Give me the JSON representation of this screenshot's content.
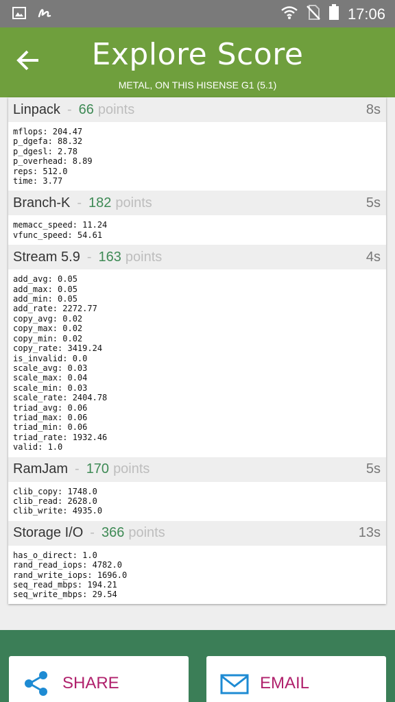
{
  "status_bar": {
    "time": "17:06"
  },
  "header": {
    "title": "Explore Score",
    "subtitle": "METAL, ON THIS HISENSE G1 (5.1)"
  },
  "unit_label": "points",
  "sections": [
    {
      "name": "Linpack",
      "score": "66",
      "duration": "8s",
      "metrics": [
        "mflops: 204.47",
        "p_dgefa: 88.32",
        "p_dgesl: 2.78",
        "p_overhead: 8.89",
        "reps: 512.0",
        "time: 3.77"
      ]
    },
    {
      "name": "Branch-K",
      "score": "182",
      "duration": "5s",
      "metrics": [
        "memacc_speed: 11.24",
        "vfunc_speed: 54.61"
      ]
    },
    {
      "name": "Stream 5.9",
      "score": "163",
      "duration": "4s",
      "metrics": [
        "add_avg: 0.05",
        "add_max: 0.05",
        "add_min: 0.05",
        "add_rate: 2272.77",
        "copy_avg: 0.02",
        "copy_max: 0.02",
        "copy_min: 0.02",
        "copy_rate: 3419.24",
        "is_invalid: 0.0",
        "scale_avg: 0.03",
        "scale_max: 0.04",
        "scale_min: 0.03",
        "scale_rate: 2404.78",
        "triad_avg: 0.06",
        "triad_max: 0.06",
        "triad_min: 0.06",
        "triad_rate: 1932.46",
        "valid: 1.0"
      ]
    },
    {
      "name": "RamJam",
      "score": "170",
      "duration": "5s",
      "metrics": [
        "clib_copy: 1748.0",
        "clib_read: 2628.0",
        "clib_write: 4935.0"
      ]
    },
    {
      "name": "Storage I/O",
      "score": "366",
      "duration": "13s",
      "metrics": [
        "has_o_direct: 1.0",
        "rand_read_iops: 4782.0",
        "rand_write_iops: 1696.0",
        "seq_read_mbps: 194.21",
        "seq_write_mbps: 29.54"
      ]
    }
  ],
  "actions": {
    "share_label": "SHARE",
    "email_label": "EMAIL"
  },
  "colors": {
    "header_bg": "#6f9f3d",
    "score_green": "#3e8a55",
    "footer_bg": "#3b7e57",
    "action_text": "#b0216c",
    "icon_blue": "#1e8bd3"
  }
}
